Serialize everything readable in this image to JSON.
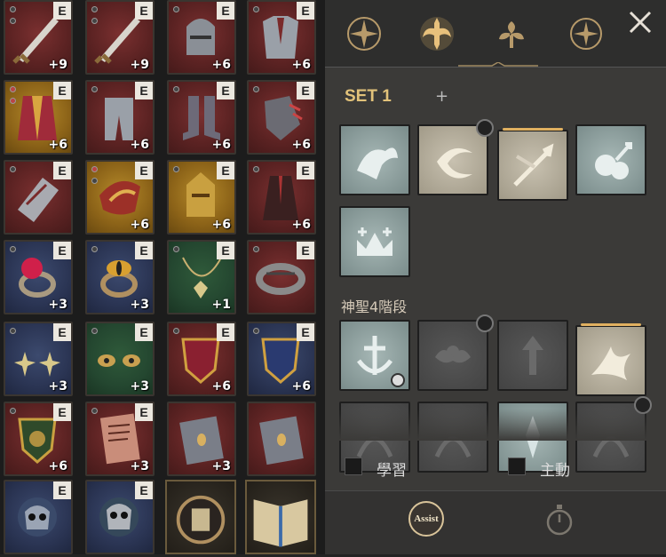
{
  "inventory": {
    "slots": [
      {
        "item": "sword-icon",
        "badge": "E",
        "level": "+9",
        "bg": "red",
        "dots": [
          "gray",
          "gray"
        ]
      },
      {
        "item": "sword-icon",
        "badge": "E",
        "level": "+9",
        "bg": "red",
        "dots": [
          "gray",
          "gray"
        ]
      },
      {
        "item": "helmet-icon",
        "badge": "E",
        "level": "+6",
        "bg": "red",
        "dots": [
          "gray"
        ]
      },
      {
        "item": "chest-armor-icon",
        "badge": "E",
        "level": "+6",
        "bg": "red",
        "dots": [
          "gray"
        ]
      },
      {
        "item": "robe-icon",
        "badge": "E",
        "level": "+6",
        "bg": "gold",
        "dots": [
          "red",
          "red"
        ]
      },
      {
        "item": "leg-armor-icon",
        "badge": "E",
        "level": "+6",
        "bg": "red",
        "dots": [
          "gray"
        ]
      },
      {
        "item": "boots-icon",
        "badge": "E",
        "level": "+6",
        "bg": "red",
        "dots": [
          "gray"
        ]
      },
      {
        "item": "gauntlet-icon",
        "badge": "E",
        "level": "+6",
        "bg": "red",
        "dots": [
          "gray"
        ]
      },
      {
        "item": "bracer-icon",
        "badge": "E",
        "level": "",
        "bg": "red",
        "dots": [
          "gray"
        ]
      },
      {
        "item": "shoulder-icon",
        "badge": "E",
        "level": "+6",
        "bg": "gold",
        "dots": [
          "red",
          "gray"
        ]
      },
      {
        "item": "gold-helmet-icon",
        "badge": "E",
        "level": "+6",
        "bg": "gold",
        "dots": [
          "gray"
        ]
      },
      {
        "item": "cloak-icon",
        "badge": "E",
        "level": "+6",
        "bg": "red",
        "dots": [
          "gray"
        ]
      },
      {
        "item": "ruby-ring-icon",
        "badge": "E",
        "level": "+3",
        "bg": "blue",
        "dots": [
          "gray"
        ]
      },
      {
        "item": "eye-ring-icon",
        "badge": "E",
        "level": "+3",
        "bg": "blue",
        "dots": [
          "gray"
        ]
      },
      {
        "item": "necklace-icon",
        "badge": "E",
        "level": "+1",
        "bg": "green",
        "dots": [
          "gray"
        ]
      },
      {
        "item": "band-ring-icon",
        "badge": "E",
        "level": "",
        "bg": "red",
        "dots": [
          "gray"
        ]
      },
      {
        "item": "star-earrings-icon",
        "badge": "E",
        "level": "+3",
        "bg": "blue",
        "dots": [
          "gray"
        ]
      },
      {
        "item": "eye-earrings-icon",
        "badge": "E",
        "level": "+3",
        "bg": "green",
        "dots": [
          "gray"
        ]
      },
      {
        "item": "red-emblem-icon",
        "badge": "E",
        "level": "+6",
        "bg": "red",
        "dots": [
          "gray"
        ]
      },
      {
        "item": "blue-emblem-icon",
        "badge": "E",
        "level": "+6",
        "bg": "blue",
        "dots": [
          "gray"
        ]
      },
      {
        "item": "shield-emblem-icon",
        "badge": "E",
        "level": "+6",
        "bg": "red",
        "dots": [
          "gray"
        ]
      },
      {
        "item": "scroll-icon",
        "badge": "E",
        "level": "+3",
        "bg": "red",
        "dots": [
          "gray"
        ]
      },
      {
        "item": "tablet-icon",
        "badge": "",
        "level": "+3",
        "bg": "red",
        "dots": []
      },
      {
        "item": "tablet-icon",
        "badge": "",
        "level": "",
        "bg": "red",
        "dots": []
      },
      {
        "item": "skull-ram-icon",
        "badge": "E",
        "level": "",
        "bg": "blue",
        "dots": []
      },
      {
        "item": "skull-icon",
        "badge": "E",
        "level": "",
        "bg": "blue",
        "dots": []
      },
      {
        "item": "orb-book-icon",
        "badge": "",
        "level": "",
        "bg": "book",
        "dots": []
      },
      {
        "item": "open-book-icon",
        "badge": "",
        "level": "",
        "bg": "book",
        "dots": []
      }
    ]
  },
  "panel": {
    "tabs": [
      "compass-star-icon",
      "sword-wings-icon",
      "flower-icon",
      "compass-icon"
    ],
    "active_tab": 1,
    "close_icon": "close-icon",
    "set_label": "SET 1",
    "add_label": "+",
    "skills_row1": [
      "winged-beast-skill-icon",
      "crescent-slash-skill-icon",
      "arrow-strike-skill-icon",
      "potion-skill-icon",
      "holy-crown-skill-icon"
    ],
    "section_label": "神聖4階段",
    "skills_row2": [
      "anchor-skill-icon",
      "angel-skill-icon",
      "ascend-skill-icon",
      "phoenix-skill-icon",
      "ghost-skill-icon",
      "ghost-skill-icon",
      "crystal-skill-icon",
      "ghost-skill-icon"
    ],
    "learn_label": "學習",
    "active_label": "主動",
    "assist_label": "Assist",
    "stopwatch_icon": "stopwatch-icon"
  },
  "colors": {
    "set_gold": "#e2c27a",
    "badge_bg": "#ebe7df",
    "panel_bg": "#3b3a38"
  }
}
